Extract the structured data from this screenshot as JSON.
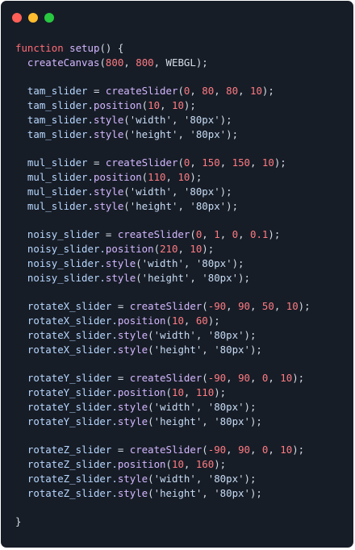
{
  "window": {
    "controls": [
      "close",
      "minimize",
      "maximize"
    ],
    "colors": {
      "close": "#ff5f57",
      "minimize": "#febc2e",
      "maximize": "#28c840",
      "background": "#171d27"
    }
  },
  "code": {
    "lines": [
      [
        {
          "text": "function ",
          "cls": "kw"
        },
        {
          "text": "setup",
          "cls": "fn"
        },
        {
          "text": "() {",
          "cls": "punct"
        }
      ],
      [
        {
          "text": "  ",
          "cls": "punct"
        },
        {
          "text": "createCanvas",
          "cls": "fn"
        },
        {
          "text": "(",
          "cls": "punct"
        },
        {
          "text": "800",
          "cls": "num"
        },
        {
          "text": ", ",
          "cls": "punct"
        },
        {
          "text": "800",
          "cls": "num"
        },
        {
          "text": ", WEBGL);",
          "cls": "punct"
        }
      ],
      [],
      [
        {
          "text": "  tam_slider ",
          "cls": "id"
        },
        {
          "text": "= ",
          "cls": "punct"
        },
        {
          "text": "createSlider",
          "cls": "fn"
        },
        {
          "text": "(",
          "cls": "punct"
        },
        {
          "text": "0",
          "cls": "num"
        },
        {
          "text": ", ",
          "cls": "punct"
        },
        {
          "text": "80",
          "cls": "num"
        },
        {
          "text": ", ",
          "cls": "punct"
        },
        {
          "text": "80",
          "cls": "num"
        },
        {
          "text": ", ",
          "cls": "punct"
        },
        {
          "text": "10",
          "cls": "num"
        },
        {
          "text": ");",
          "cls": "punct"
        }
      ],
      [
        {
          "text": "  tam_slider.",
          "cls": "id"
        },
        {
          "text": "position",
          "cls": "fn"
        },
        {
          "text": "(",
          "cls": "punct"
        },
        {
          "text": "10",
          "cls": "num"
        },
        {
          "text": ", ",
          "cls": "punct"
        },
        {
          "text": "10",
          "cls": "num"
        },
        {
          "text": ");",
          "cls": "punct"
        }
      ],
      [
        {
          "text": "  tam_slider.",
          "cls": "id"
        },
        {
          "text": "style",
          "cls": "fn"
        },
        {
          "text": "('",
          "cls": "punct"
        },
        {
          "text": "width",
          "cls": "str"
        },
        {
          "text": "', '",
          "cls": "punct"
        },
        {
          "text": "80px",
          "cls": "str"
        },
        {
          "text": "');",
          "cls": "punct"
        }
      ],
      [
        {
          "text": "  tam_slider.",
          "cls": "id"
        },
        {
          "text": "style",
          "cls": "fn"
        },
        {
          "text": "('",
          "cls": "punct"
        },
        {
          "text": "height",
          "cls": "str"
        },
        {
          "text": "', '",
          "cls": "punct"
        },
        {
          "text": "80px",
          "cls": "str"
        },
        {
          "text": "');",
          "cls": "punct"
        }
      ],
      [],
      [
        {
          "text": "  mul_slider ",
          "cls": "id"
        },
        {
          "text": "= ",
          "cls": "punct"
        },
        {
          "text": "createSlider",
          "cls": "fn"
        },
        {
          "text": "(",
          "cls": "punct"
        },
        {
          "text": "0",
          "cls": "num"
        },
        {
          "text": ", ",
          "cls": "punct"
        },
        {
          "text": "150",
          "cls": "num"
        },
        {
          "text": ", ",
          "cls": "punct"
        },
        {
          "text": "150",
          "cls": "num"
        },
        {
          "text": ", ",
          "cls": "punct"
        },
        {
          "text": "10",
          "cls": "num"
        },
        {
          "text": ");",
          "cls": "punct"
        }
      ],
      [
        {
          "text": "  mul_slider.",
          "cls": "id"
        },
        {
          "text": "position",
          "cls": "fn"
        },
        {
          "text": "(",
          "cls": "punct"
        },
        {
          "text": "110",
          "cls": "num"
        },
        {
          "text": ", ",
          "cls": "punct"
        },
        {
          "text": "10",
          "cls": "num"
        },
        {
          "text": ");",
          "cls": "punct"
        }
      ],
      [
        {
          "text": "  mul_slider.",
          "cls": "id"
        },
        {
          "text": "style",
          "cls": "fn"
        },
        {
          "text": "('",
          "cls": "punct"
        },
        {
          "text": "width",
          "cls": "str"
        },
        {
          "text": "', '",
          "cls": "punct"
        },
        {
          "text": "80px",
          "cls": "str"
        },
        {
          "text": "');",
          "cls": "punct"
        }
      ],
      [
        {
          "text": "  mul_slider.",
          "cls": "id"
        },
        {
          "text": "style",
          "cls": "fn"
        },
        {
          "text": "('",
          "cls": "punct"
        },
        {
          "text": "height",
          "cls": "str"
        },
        {
          "text": "', '",
          "cls": "punct"
        },
        {
          "text": "80px",
          "cls": "str"
        },
        {
          "text": "');",
          "cls": "punct"
        }
      ],
      [],
      [
        {
          "text": "  noisy_slider ",
          "cls": "id"
        },
        {
          "text": "= ",
          "cls": "punct"
        },
        {
          "text": "createSlider",
          "cls": "fn"
        },
        {
          "text": "(",
          "cls": "punct"
        },
        {
          "text": "0",
          "cls": "num"
        },
        {
          "text": ", ",
          "cls": "punct"
        },
        {
          "text": "1",
          "cls": "num"
        },
        {
          "text": ", ",
          "cls": "punct"
        },
        {
          "text": "0",
          "cls": "num"
        },
        {
          "text": ", ",
          "cls": "punct"
        },
        {
          "text": "0.1",
          "cls": "num"
        },
        {
          "text": ");",
          "cls": "punct"
        }
      ],
      [
        {
          "text": "  noisy_slider.",
          "cls": "id"
        },
        {
          "text": "position",
          "cls": "fn"
        },
        {
          "text": "(",
          "cls": "punct"
        },
        {
          "text": "210",
          "cls": "num"
        },
        {
          "text": ", ",
          "cls": "punct"
        },
        {
          "text": "10",
          "cls": "num"
        },
        {
          "text": ");",
          "cls": "punct"
        }
      ],
      [
        {
          "text": "  noisy_slider.",
          "cls": "id"
        },
        {
          "text": "style",
          "cls": "fn"
        },
        {
          "text": "('",
          "cls": "punct"
        },
        {
          "text": "width",
          "cls": "str"
        },
        {
          "text": "', '",
          "cls": "punct"
        },
        {
          "text": "80px",
          "cls": "str"
        },
        {
          "text": "');",
          "cls": "punct"
        }
      ],
      [
        {
          "text": "  noisy_slider.",
          "cls": "id"
        },
        {
          "text": "style",
          "cls": "fn"
        },
        {
          "text": "('",
          "cls": "punct"
        },
        {
          "text": "height",
          "cls": "str"
        },
        {
          "text": "', '",
          "cls": "punct"
        },
        {
          "text": "80px",
          "cls": "str"
        },
        {
          "text": "');",
          "cls": "punct"
        }
      ],
      [],
      [
        {
          "text": "  rotateX_slider ",
          "cls": "id"
        },
        {
          "text": "= ",
          "cls": "punct"
        },
        {
          "text": "createSlider",
          "cls": "fn"
        },
        {
          "text": "(",
          "cls": "punct"
        },
        {
          "text": "-90",
          "cls": "num"
        },
        {
          "text": ", ",
          "cls": "punct"
        },
        {
          "text": "90",
          "cls": "num"
        },
        {
          "text": ", ",
          "cls": "punct"
        },
        {
          "text": "50",
          "cls": "num"
        },
        {
          "text": ", ",
          "cls": "punct"
        },
        {
          "text": "10",
          "cls": "num"
        },
        {
          "text": ");",
          "cls": "punct"
        }
      ],
      [
        {
          "text": "  rotateX_slider.",
          "cls": "id"
        },
        {
          "text": "position",
          "cls": "fn"
        },
        {
          "text": "(",
          "cls": "punct"
        },
        {
          "text": "10",
          "cls": "num"
        },
        {
          "text": ", ",
          "cls": "punct"
        },
        {
          "text": "60",
          "cls": "num"
        },
        {
          "text": ");",
          "cls": "punct"
        }
      ],
      [
        {
          "text": "  rotateX_slider.",
          "cls": "id"
        },
        {
          "text": "style",
          "cls": "fn"
        },
        {
          "text": "('",
          "cls": "punct"
        },
        {
          "text": "width",
          "cls": "str"
        },
        {
          "text": "', '",
          "cls": "punct"
        },
        {
          "text": "80px",
          "cls": "str"
        },
        {
          "text": "');",
          "cls": "punct"
        }
      ],
      [
        {
          "text": "  rotateX_slider.",
          "cls": "id"
        },
        {
          "text": "style",
          "cls": "fn"
        },
        {
          "text": "('",
          "cls": "punct"
        },
        {
          "text": "height",
          "cls": "str"
        },
        {
          "text": "', '",
          "cls": "punct"
        },
        {
          "text": "80px",
          "cls": "str"
        },
        {
          "text": "');",
          "cls": "punct"
        }
      ],
      [],
      [
        {
          "text": "  rotateY_slider ",
          "cls": "id"
        },
        {
          "text": "= ",
          "cls": "punct"
        },
        {
          "text": "createSlider",
          "cls": "fn"
        },
        {
          "text": "(",
          "cls": "punct"
        },
        {
          "text": "-90",
          "cls": "num"
        },
        {
          "text": ", ",
          "cls": "punct"
        },
        {
          "text": "90",
          "cls": "num"
        },
        {
          "text": ", ",
          "cls": "punct"
        },
        {
          "text": "0",
          "cls": "num"
        },
        {
          "text": ", ",
          "cls": "punct"
        },
        {
          "text": "10",
          "cls": "num"
        },
        {
          "text": ");",
          "cls": "punct"
        }
      ],
      [
        {
          "text": "  rotateY_slider.",
          "cls": "id"
        },
        {
          "text": "position",
          "cls": "fn"
        },
        {
          "text": "(",
          "cls": "punct"
        },
        {
          "text": "10",
          "cls": "num"
        },
        {
          "text": ", ",
          "cls": "punct"
        },
        {
          "text": "110",
          "cls": "num"
        },
        {
          "text": ");",
          "cls": "punct"
        }
      ],
      [
        {
          "text": "  rotateY_slider.",
          "cls": "id"
        },
        {
          "text": "style",
          "cls": "fn"
        },
        {
          "text": "('",
          "cls": "punct"
        },
        {
          "text": "width",
          "cls": "str"
        },
        {
          "text": "', '",
          "cls": "punct"
        },
        {
          "text": "80px",
          "cls": "str"
        },
        {
          "text": "');",
          "cls": "punct"
        }
      ],
      [
        {
          "text": "  rotateY_slider.",
          "cls": "id"
        },
        {
          "text": "style",
          "cls": "fn"
        },
        {
          "text": "('",
          "cls": "punct"
        },
        {
          "text": "height",
          "cls": "str"
        },
        {
          "text": "', '",
          "cls": "punct"
        },
        {
          "text": "80px",
          "cls": "str"
        },
        {
          "text": "');",
          "cls": "punct"
        }
      ],
      [],
      [
        {
          "text": "  rotateZ_slider ",
          "cls": "id"
        },
        {
          "text": "= ",
          "cls": "punct"
        },
        {
          "text": "createSlider",
          "cls": "fn"
        },
        {
          "text": "(",
          "cls": "punct"
        },
        {
          "text": "-90",
          "cls": "num"
        },
        {
          "text": ", ",
          "cls": "punct"
        },
        {
          "text": "90",
          "cls": "num"
        },
        {
          "text": ", ",
          "cls": "punct"
        },
        {
          "text": "0",
          "cls": "num"
        },
        {
          "text": ", ",
          "cls": "punct"
        },
        {
          "text": "10",
          "cls": "num"
        },
        {
          "text": ");",
          "cls": "punct"
        }
      ],
      [
        {
          "text": "  rotateZ_slider.",
          "cls": "id"
        },
        {
          "text": "position",
          "cls": "fn"
        },
        {
          "text": "(",
          "cls": "punct"
        },
        {
          "text": "10",
          "cls": "num"
        },
        {
          "text": ", ",
          "cls": "punct"
        },
        {
          "text": "160",
          "cls": "num"
        },
        {
          "text": ");",
          "cls": "punct"
        }
      ],
      [
        {
          "text": "  rotateZ_slider.",
          "cls": "id"
        },
        {
          "text": "style",
          "cls": "fn"
        },
        {
          "text": "('",
          "cls": "punct"
        },
        {
          "text": "width",
          "cls": "str"
        },
        {
          "text": "', '",
          "cls": "punct"
        },
        {
          "text": "80px",
          "cls": "str"
        },
        {
          "text": "');",
          "cls": "punct"
        }
      ],
      [
        {
          "text": "  rotateZ_slider.",
          "cls": "id"
        },
        {
          "text": "style",
          "cls": "fn"
        },
        {
          "text": "('",
          "cls": "punct"
        },
        {
          "text": "height",
          "cls": "str"
        },
        {
          "text": "', '",
          "cls": "punct"
        },
        {
          "text": "80px",
          "cls": "str"
        },
        {
          "text": "');",
          "cls": "punct"
        }
      ],
      [],
      [
        {
          "text": "}",
          "cls": "punct"
        }
      ]
    ]
  }
}
